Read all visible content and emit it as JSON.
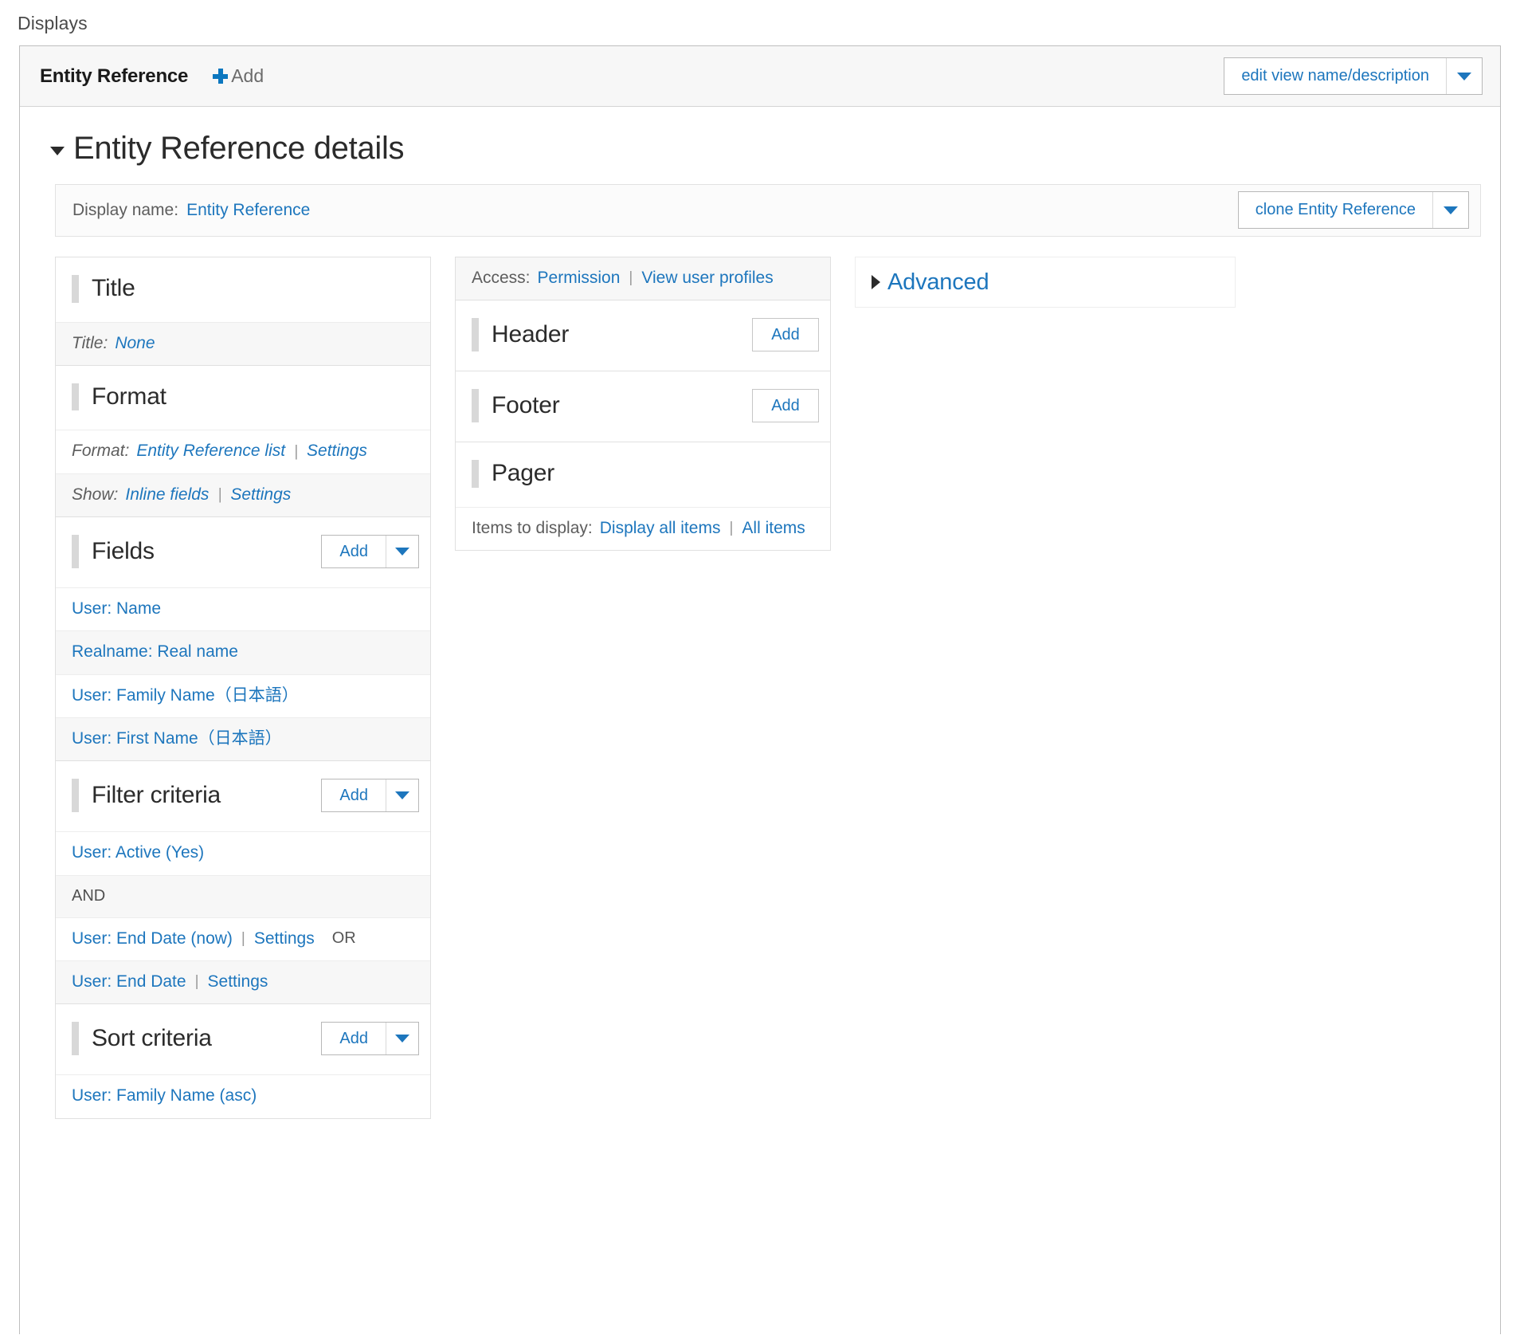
{
  "page": {
    "displays_label": "Displays"
  },
  "display_tabs": {
    "active_tab": "Entity Reference",
    "add_label": "Add",
    "add_icon": "plus-icon",
    "edit_view_button": {
      "label": "edit view name/description",
      "toggle_icon": "chevron-down-icon"
    }
  },
  "details": {
    "heading": "Entity Reference details",
    "collapse_icon": "triangle-down-icon",
    "display_name_label": "Display name:",
    "display_name_value": "Entity Reference",
    "clone_button": {
      "label": "clone Entity Reference",
      "toggle_icon": "chevron-down-icon"
    }
  },
  "columns": {
    "first": [
      {
        "id": "title",
        "title": "Title",
        "button": null,
        "rows": [
          {
            "shaded": true,
            "italic": true,
            "label": "Title:",
            "links": [
              "None"
            ],
            "separators": [],
            "suffix": ""
          }
        ]
      },
      {
        "id": "format",
        "title": "Format",
        "button": null,
        "rows": [
          {
            "shaded": false,
            "italic": true,
            "label": "Format:",
            "links": [
              "Entity Reference list",
              "Settings"
            ],
            "separators": [
              "|"
            ],
            "suffix": ""
          },
          {
            "shaded": true,
            "italic": true,
            "label": "Show:",
            "links": [
              "Inline fields",
              "Settings"
            ],
            "separators": [
              "|"
            ],
            "suffix": ""
          }
        ]
      },
      {
        "id": "fields",
        "title": "Fields",
        "button": {
          "label": "Add",
          "type": "dropbutton",
          "toggle_icon": "chevron-down-icon"
        },
        "rows": [
          {
            "shaded": false,
            "italic": false,
            "label": "",
            "links": [
              "User: Name"
            ],
            "separators": [],
            "suffix": ""
          },
          {
            "shaded": true,
            "italic": false,
            "label": "",
            "links": [
              "Realname: Real name"
            ],
            "separators": [],
            "suffix": ""
          },
          {
            "shaded": false,
            "italic": false,
            "label": "",
            "links": [
              "User: Family Name（日本語）"
            ],
            "separators": [],
            "suffix": ""
          },
          {
            "shaded": true,
            "italic": false,
            "label": "",
            "links": [
              "User: First Name（日本語）"
            ],
            "separators": [],
            "suffix": ""
          }
        ]
      },
      {
        "id": "filter-criteria",
        "title": "Filter criteria",
        "button": {
          "label": "Add",
          "type": "dropbutton",
          "toggle_icon": "chevron-down-icon"
        },
        "rows": [
          {
            "shaded": false,
            "italic": false,
            "label": "",
            "links": [
              "User: Active (Yes)"
            ],
            "separators": [],
            "suffix": ""
          },
          {
            "shaded": true,
            "italic": false,
            "label": "",
            "links": [],
            "separators": [],
            "suffix": "",
            "plaintext": "AND"
          },
          {
            "shaded": false,
            "italic": false,
            "label": "",
            "links": [
              "User: End Date (now)",
              "Settings"
            ],
            "separators": [
              "|"
            ],
            "suffix": "OR"
          },
          {
            "shaded": true,
            "italic": false,
            "label": "",
            "links": [
              "User: End Date",
              "Settings"
            ],
            "separators": [
              "|"
            ],
            "suffix": ""
          }
        ]
      },
      {
        "id": "sort-criteria",
        "title": "Sort criteria",
        "button": {
          "label": "Add",
          "type": "dropbutton",
          "toggle_icon": "chevron-down-icon"
        },
        "rows": [
          {
            "shaded": false,
            "italic": false,
            "label": "",
            "links": [
              "User: Family Name (asc)"
            ],
            "separators": [],
            "suffix": ""
          }
        ]
      }
    ],
    "second": {
      "access_row": {
        "label": "Access:",
        "links": [
          "Permission",
          "View user profiles"
        ],
        "separators": [
          "|"
        ]
      },
      "buckets": [
        {
          "id": "header",
          "title": "Header",
          "button": {
            "label": "Add",
            "type": "plain"
          },
          "rows": []
        },
        {
          "id": "footer",
          "title": "Footer",
          "button": {
            "label": "Add",
            "type": "plain"
          },
          "rows": []
        },
        {
          "id": "pager",
          "title": "Pager",
          "button": null,
          "rows": [
            {
              "shaded": false,
              "italic": false,
              "label": "Items to display:",
              "links": [
                "Display all items",
                "All items"
              ],
              "separators": [
                "|"
              ],
              "suffix": ""
            }
          ]
        }
      ]
    },
    "third": {
      "advanced": {
        "label": "Advanced",
        "expand_icon": "triangle-right-icon",
        "expanded": false
      }
    }
  },
  "colors": {
    "link": "#1d76bd",
    "heading": "#2b2b2b",
    "shaded_row": "#f7f7f7",
    "bucket_bar": "#d8d8d8",
    "border": "#e0e0e0"
  }
}
